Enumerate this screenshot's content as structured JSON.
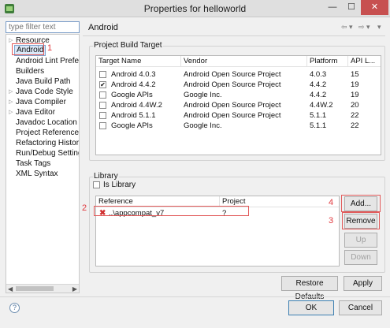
{
  "window": {
    "title": "Properties for helloworld",
    "minimize": "—",
    "maximize": "☐",
    "close": "✕"
  },
  "filter": {
    "placeholder": "type filter text"
  },
  "tree": {
    "items": [
      {
        "label": "Resource",
        "expandable": true
      },
      {
        "label": "Android",
        "selected": true
      },
      {
        "label": "Android Lint Prefere"
      },
      {
        "label": "Builders"
      },
      {
        "label": "Java Build Path"
      },
      {
        "label": "Java Code Style",
        "expandable": true
      },
      {
        "label": "Java Compiler",
        "expandable": true
      },
      {
        "label": "Java Editor",
        "expandable": true
      },
      {
        "label": "Javadoc Location"
      },
      {
        "label": "Project References"
      },
      {
        "label": "Refactoring History"
      },
      {
        "label": "Run/Debug Setting:"
      },
      {
        "label": "Task Tags"
      },
      {
        "label": "XML Syntax"
      }
    ]
  },
  "annotations": {
    "n1": "1",
    "n2": "2",
    "n3": "3",
    "n4": "4"
  },
  "page": {
    "title": "Android",
    "nav_back": "⇦ ▾",
    "nav_fwd": "⇨ ▾",
    "nav_menu": "▾"
  },
  "build_target": {
    "group_label": "Project Build Target",
    "columns": [
      "Target Name",
      "Vendor",
      "Platform",
      "API L..."
    ],
    "rows": [
      {
        "name": "Android 4.0.3",
        "vendor": "Android Open Source Project",
        "platform": "4.0.3",
        "api": "15",
        "checked": false
      },
      {
        "name": "Android 4.4.2",
        "vendor": "Android Open Source Project",
        "platform": "4.4.2",
        "api": "19",
        "checked": true
      },
      {
        "name": "Google APIs",
        "vendor": "Google Inc.",
        "platform": "4.4.2",
        "api": "19",
        "checked": false
      },
      {
        "name": "Android 4.4W.2",
        "vendor": "Android Open Source Project",
        "platform": "4.4W.2",
        "api": "20",
        "checked": false
      },
      {
        "name": "Android 5.1.1",
        "vendor": "Android Open Source Project",
        "platform": "5.1.1",
        "api": "22",
        "checked": false
      },
      {
        "name": "Google APIs",
        "vendor": "Google Inc.",
        "platform": "5.1.1",
        "api": "22",
        "checked": false
      }
    ]
  },
  "library": {
    "group_label": "Library",
    "is_library_label": "Is Library",
    "is_library_checked": false,
    "columns": [
      "Reference",
      "Project"
    ],
    "rows": [
      {
        "reference": "..\\appcompat_v7",
        "project": "?",
        "status": "error"
      }
    ],
    "buttons": {
      "add": "Add...",
      "remove": "Remove",
      "up": "Up",
      "down": "Down"
    }
  },
  "page_buttons": {
    "restore_defaults": "Restore Defaults",
    "apply": "Apply"
  },
  "dialog_buttons": {
    "help": "?",
    "ok": "OK",
    "cancel": "Cancel"
  },
  "colors": {
    "annotation": "#e0393e",
    "error": "#d03030",
    "selection": "#dbe8f8"
  }
}
